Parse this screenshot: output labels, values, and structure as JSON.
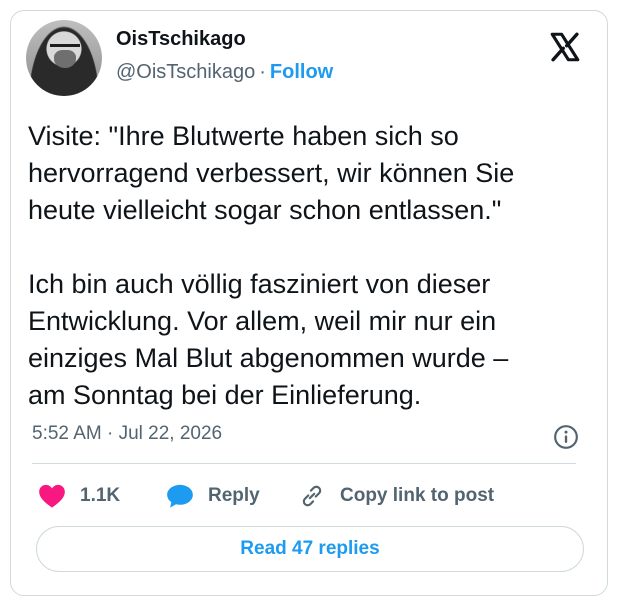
{
  "author": {
    "display_name": "OisTschikago",
    "handle": "@OisTschikago",
    "separator": "·",
    "follow_label": "Follow"
  },
  "tweet": {
    "text": "Visite: \"Ihre Blutwerte haben sich so\nhervorragend verbessert, wir können Sie\nheute vielleicht sogar schon entlassen.\"\n\nIch bin auch völlig fasziniert von dieser\nEntwicklung. Vor allem, weil mir nur ein\neinziges Mal Blut abgenommen wurde –\nam Sonntag bei der Einlieferung.",
    "timestamp": "5:52 AM · Jul 22, 2026"
  },
  "actions": {
    "like_count": "1.1K",
    "reply_label": "Reply",
    "copy_link_label": "Copy link to post"
  },
  "read_replies_label": "Read 47 replies",
  "icons": {
    "platform_logo": "x-logo-icon",
    "info": "info-icon",
    "like": "heart-icon",
    "reply": "speech-bubble-icon",
    "copy_link": "link-icon"
  },
  "colors": {
    "accent": "#1d9bf0",
    "like": "#f91880",
    "text_primary": "#0f1419",
    "text_secondary": "#536471",
    "border": "#cfd9de"
  }
}
